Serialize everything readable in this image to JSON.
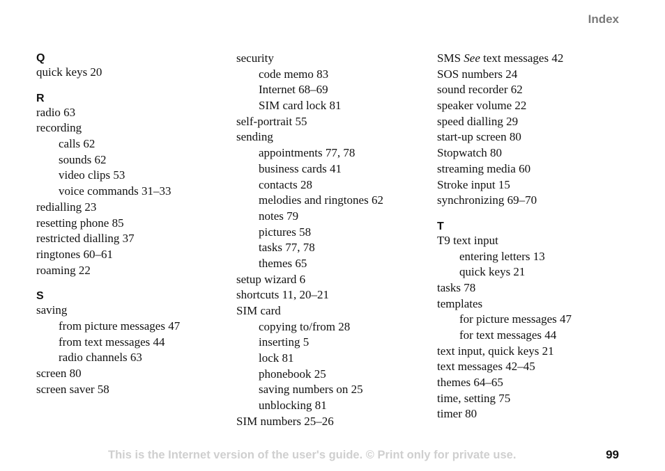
{
  "header": {
    "title": "Index"
  },
  "columns": [
    {
      "blocks": [
        {
          "letter": "Q",
          "entries": [
            {
              "text": "quick keys 20",
              "level": 0
            }
          ]
        },
        {
          "letter": "R",
          "entries": [
            {
              "text": "radio 63",
              "level": 0
            },
            {
              "text": "recording",
              "level": 0
            },
            {
              "text": "calls 62",
              "level": 1
            },
            {
              "text": "sounds 62",
              "level": 1
            },
            {
              "text": "video clips 53",
              "level": 1
            },
            {
              "text": "voice commands 31–33",
              "level": 1
            },
            {
              "text": "redialling 23",
              "level": 0
            },
            {
              "text": "resetting phone 85",
              "level": 0
            },
            {
              "text": "restricted dialling 37",
              "level": 0
            },
            {
              "text": "ringtones 60–61",
              "level": 0
            },
            {
              "text": "roaming 22",
              "level": 0
            }
          ]
        },
        {
          "letter": "S",
          "entries": [
            {
              "text": "saving",
              "level": 0
            },
            {
              "text": "from picture messages 47",
              "level": 1
            },
            {
              "text": "from text messages 44",
              "level": 1
            },
            {
              "text": "radio channels 63",
              "level": 1
            },
            {
              "text": "screen 80",
              "level": 0
            },
            {
              "text": "screen saver 58",
              "level": 0
            }
          ]
        }
      ]
    },
    {
      "blocks": [
        {
          "letter": "",
          "entries": [
            {
              "text": "security",
              "level": 0
            },
            {
              "text": "code memo 83",
              "level": 1
            },
            {
              "text": "Internet 68–69",
              "level": 1
            },
            {
              "text": "SIM card lock 81",
              "level": 1
            },
            {
              "text": "self-portrait 55",
              "level": 0
            },
            {
              "text": "sending",
              "level": 0
            },
            {
              "text": "appointments 77, 78",
              "level": 1
            },
            {
              "text": "business cards 41",
              "level": 1
            },
            {
              "text": "contacts 28",
              "level": 1
            },
            {
              "text": "melodies and ringtones 62",
              "level": 1
            },
            {
              "text": "notes 79",
              "level": 1
            },
            {
              "text": "pictures 58",
              "level": 1
            },
            {
              "text": "tasks 77, 78",
              "level": 1
            },
            {
              "text": "themes 65",
              "level": 1
            },
            {
              "text": "setup wizard 6",
              "level": 0
            },
            {
              "text": "shortcuts 11, 20–21",
              "level": 0
            },
            {
              "text": "SIM card",
              "level": 0
            },
            {
              "text": "copying to/from 28",
              "level": 1
            },
            {
              "text": "inserting 5",
              "level": 1
            },
            {
              "text": "lock 81",
              "level": 1
            },
            {
              "text": "phonebook 25",
              "level": 1
            },
            {
              "text": "saving numbers on 25",
              "level": 1
            },
            {
              "text": "unblocking 81",
              "level": 1
            },
            {
              "text": "SIM numbers 25–26",
              "level": 0
            }
          ]
        }
      ]
    },
    {
      "blocks": [
        {
          "letter": "",
          "entries": [
            {
              "text": "SMS",
              "see": "See",
              "after": "text messages 42",
              "level": 0
            },
            {
              "text": "SOS numbers 24",
              "level": 0
            },
            {
              "text": "sound recorder 62",
              "level": 0
            },
            {
              "text": "speaker volume 22",
              "level": 0
            },
            {
              "text": "speed dialling 29",
              "level": 0
            },
            {
              "text": "start-up screen 80",
              "level": 0
            },
            {
              "text": "Stopwatch 80",
              "level": 0
            },
            {
              "text": "streaming media 60",
              "level": 0
            },
            {
              "text": "Stroke input 15",
              "level": 0
            },
            {
              "text": "synchronizing 69–70",
              "level": 0
            }
          ]
        },
        {
          "letter": "T",
          "entries": [
            {
              "text": "T9 text input",
              "level": 0
            },
            {
              "text": "entering letters 13",
              "level": 1
            },
            {
              "text": "quick keys 21",
              "level": 1
            },
            {
              "text": "tasks 78",
              "level": 0
            },
            {
              "text": "templates",
              "level": 0
            },
            {
              "text": "for picture messages 47",
              "level": 1
            },
            {
              "text": "for text messages 44",
              "level": 1
            },
            {
              "text": "text input, quick keys 21",
              "level": 0
            },
            {
              "text": "text messages 42–45",
              "level": 0
            },
            {
              "text": "themes 64–65",
              "level": 0
            },
            {
              "text": "time, setting 75",
              "level": 0
            },
            {
              "text": "timer 80",
              "level": 0
            }
          ]
        }
      ]
    }
  ],
  "footer": {
    "note": "This is the Internet version of the user's guide. © Print only for private use.",
    "page_number": "99"
  }
}
